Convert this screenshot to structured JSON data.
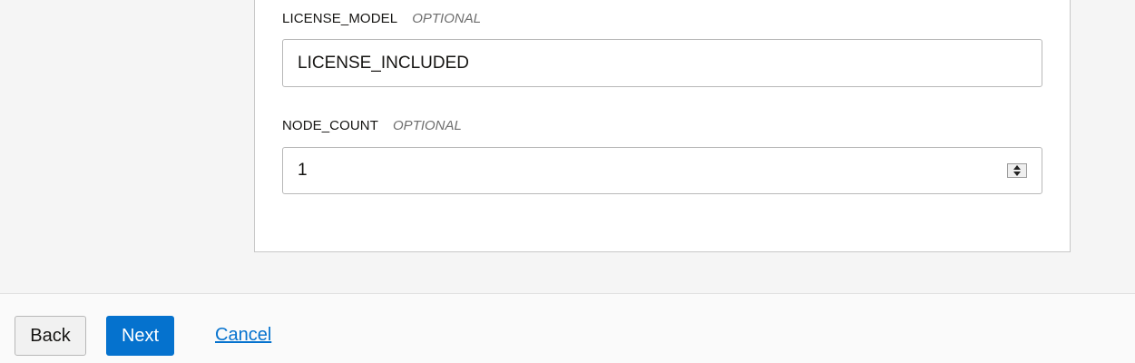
{
  "form": {
    "license_model": {
      "label": "LICENSE_MODEL",
      "optional_tag": "OPTIONAL",
      "value": "LICENSE_INCLUDED"
    },
    "node_count": {
      "label": "NODE_COUNT",
      "optional_tag": "OPTIONAL",
      "value": "1"
    }
  },
  "footer": {
    "back_label": "Back",
    "next_label": "Next",
    "cancel_label": "Cancel"
  },
  "colors": {
    "primary": "#0572ce",
    "background": "#f5f5f5",
    "panel": "#ffffff",
    "optional_text": "#6f6f6f"
  },
  "icons": {
    "stepper": "up-down-stepper-icon"
  }
}
